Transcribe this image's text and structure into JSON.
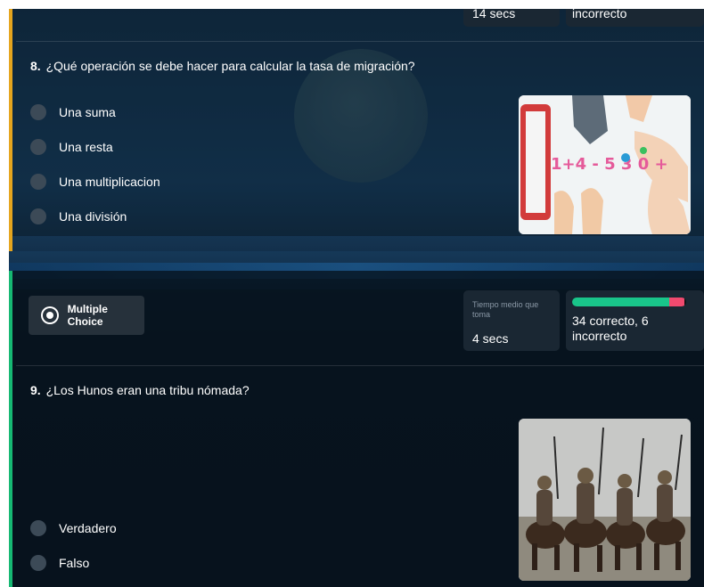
{
  "q8": {
    "time_value_partial": "14 secs",
    "result_partial": "incorrecto",
    "number": "8.",
    "text": "¿Qué operación se debe hacer para calcular la tasa de migración?",
    "options": [
      {
        "label": "Una suma"
      },
      {
        "label": "Una resta"
      },
      {
        "label": "Una multiplicacion"
      },
      {
        "label": "Una división"
      }
    ],
    "image_text": "1+4 - 5 3 0 +"
  },
  "q9": {
    "type_label": "Multiple Choice",
    "time_label": "Tiempo medio que toma",
    "time_value": "4 secs",
    "result_text": "34 correcto, 6 incorrecto",
    "correct": 34,
    "incorrect": 6,
    "number": "9.",
    "text": "¿Los Hunos eran una tribu nómada?",
    "options": [
      {
        "label": "Verdadero"
      },
      {
        "label": "Falso"
      }
    ]
  },
  "colors": {
    "q8_accent": "#e5a51e",
    "q9_accent": "#16b873",
    "correct": "#19c58a",
    "incorrect": "#f04a6f"
  }
}
